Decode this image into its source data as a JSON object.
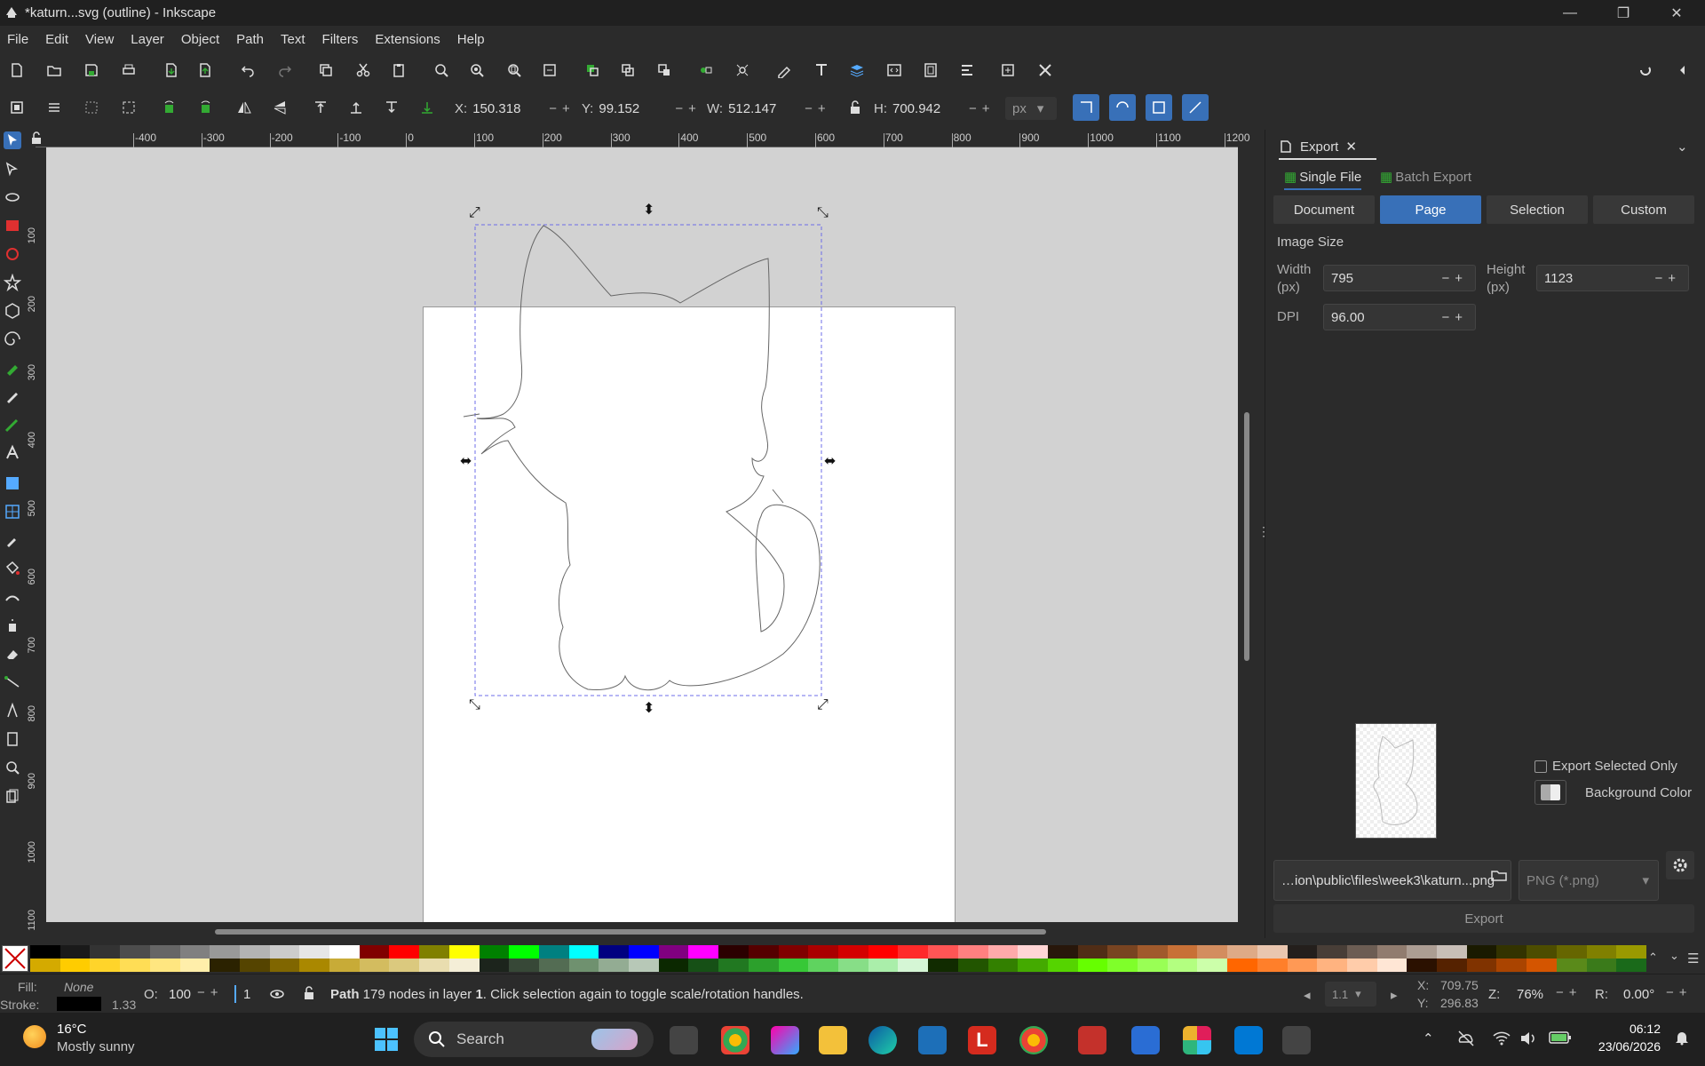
{
  "window": {
    "title": "*katurn...svg (outline) - Inkscape"
  },
  "menu": [
    "File",
    "Edit",
    "View",
    "Layer",
    "Object",
    "Path",
    "Text",
    "Filters",
    "Extensions",
    "Help"
  ],
  "controls": {
    "x_label": "X:",
    "x_value": "150.318",
    "y_label": "Y:",
    "y_value": "99.152",
    "w_label": "W:",
    "w_value": "512.147",
    "h_label": "H:",
    "h_value": "700.942",
    "unit": "px"
  },
  "rulers": {
    "top": [
      "-400",
      "-300",
      "-200",
      "-100",
      "0",
      "100",
      "200",
      "300",
      "400",
      "500",
      "600",
      "700",
      "800",
      "900",
      "1000",
      "1100",
      "1200"
    ],
    "left": [
      "100",
      "200",
      "300",
      "400",
      "500",
      "600",
      "700",
      "800",
      "900",
      "1000",
      "1100"
    ]
  },
  "export_panel": {
    "tab_title": "Export",
    "single_file": "Single File",
    "batch_export": "Batch Export",
    "area_tabs": [
      "Document",
      "Page",
      "Selection",
      "Custom"
    ],
    "active_area": "Page",
    "image_size_label": "Image Size",
    "width_label": "Width\n(px)",
    "width_value": "795",
    "height_label": "Height\n(px)",
    "height_value": "1123",
    "dpi_label": "DPI",
    "dpi_value": "96.00",
    "export_selected_only": "Export Selected Only",
    "background_color": "Background Color",
    "filename": "…ion\\public\\files\\week3\\katurn...png",
    "format": "PNG (*.png)",
    "export_button": "Export"
  },
  "status": {
    "fill_label": "Fill:",
    "fill_value": "None",
    "stroke_label": "Stroke:",
    "stroke_width": "1.33",
    "opacity_label": "O:",
    "opacity_value": "100",
    "layer_number": "1",
    "message_bold": "Path",
    "message": " 179 nodes in layer ",
    "message_layer": "1",
    "message_tail": ". Click selection again to toggle scale/rotation handles.",
    "page_indicator": "1.1",
    "cursor_x_label": "X:",
    "cursor_x": "709.75",
    "cursor_y_label": "Y:",
    "cursor_y": "296.83",
    "zoom_label": "Z:",
    "zoom_value": "76%",
    "rotate_label": "R:",
    "rotate_value": "0.00°"
  },
  "taskbar": {
    "weather_temp": "16°C",
    "weather_desc": "Mostly sunny",
    "search_placeholder": "Search",
    "time": "06:12",
    "date": "23/06/2026"
  },
  "colors": {
    "accent": "#3870b8",
    "panel_bg": "#2b2b2b",
    "canvas_bg": "#d2d2d2"
  }
}
